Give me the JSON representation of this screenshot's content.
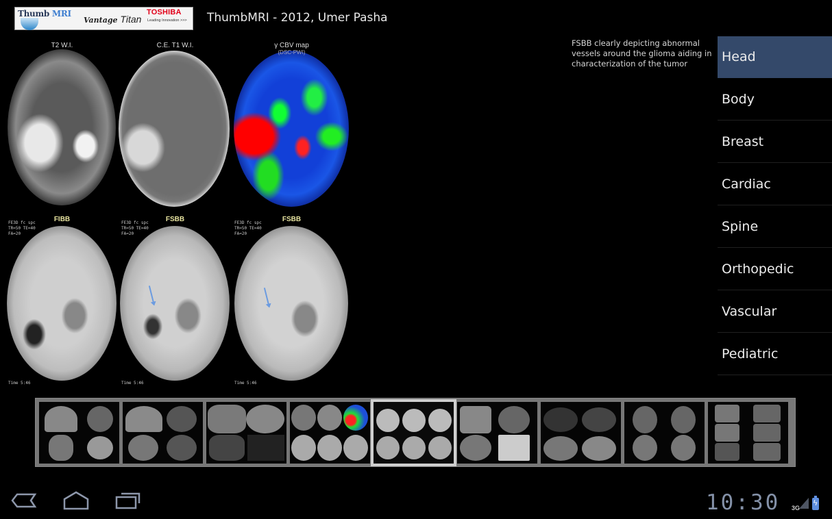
{
  "header": {
    "logo": {
      "thumb": "Thumb",
      "mri": "MRI",
      "vantage": "Vantage",
      "titan": "Titan",
      "toshiba": "TOSHIBA",
      "tagline": "Leading Innovation >>>"
    },
    "title": "ThumbMRI - 2012, Umer Pasha"
  },
  "main_image": {
    "top_row": [
      {
        "label": "T2 W.I."
      },
      {
        "label": "C.E. T1 W.I."
      },
      {
        "label": "γ CBV map",
        "sublabel": "(DSC-PWI)"
      }
    ],
    "bottom_row": [
      {
        "label": "FIBB",
        "params": "FE3D fc spc\nTR=50 TE=40\nFA=20",
        "time": "Time 5:46"
      },
      {
        "label": "FSBB",
        "params": "FE3D fc spc\nTR=50 TE=40\nFA=20",
        "time": "Time 5:46"
      },
      {
        "label": "FSBB",
        "params": "FE3D fc spc\nTR=50 TE=40\nFA=20",
        "time": "Time 5:46"
      }
    ]
  },
  "caption": "FSBB clearly depicting abnormal vessels around the glioma aiding in  characterization of the tumor",
  "menu": {
    "selected": "Head",
    "items": [
      {
        "label": "Head"
      },
      {
        "label": "Body"
      },
      {
        "label": "Breast"
      },
      {
        "label": "Cardiac"
      },
      {
        "label": "Spine"
      },
      {
        "label": "Orthopedic"
      },
      {
        "label": "Vascular"
      },
      {
        "label": "Pediatric"
      }
    ]
  },
  "thumbnails": {
    "count": 9,
    "selected_index": 4
  },
  "system_bar": {
    "clock": "10:30",
    "network": "3G",
    "icons": [
      "back-icon",
      "home-icon",
      "recent-apps-icon",
      "signal-icon",
      "battery-charging-icon"
    ]
  }
}
